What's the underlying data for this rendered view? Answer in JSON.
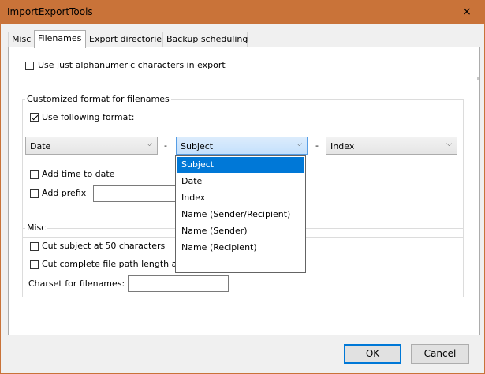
{
  "window": {
    "title": "ImportExportTools",
    "close_icon": "×"
  },
  "tabs": [
    {
      "label": "Misc"
    },
    {
      "label": "Filenames"
    },
    {
      "label": "Export directories"
    },
    {
      "label": "Backup scheduling"
    }
  ],
  "filenames": {
    "alnum_checkbox_label": "Use just alphanumeric characters in export",
    "alnum_checked": false,
    "custom_group_title": "Customized format for filenames",
    "use_format_label": "Use following format:",
    "use_format_checked": true,
    "select1_value": "Date",
    "select2_value": "Subject",
    "select3_value": "Index",
    "separator1": "-",
    "separator2": "-",
    "add_time_label": "Add time to date",
    "add_prefix_label": "Add prefix",
    "prefix_value": "",
    "dropdown_options": [
      "Subject",
      "Date",
      "Index",
      "Name (Sender/Recipient)",
      "Name (Sender)",
      "Name (Recipient)"
    ],
    "dropdown_selected": "Subject",
    "misc_group_title": "Misc",
    "cut_subject_label": "Cut subject at 50 characters",
    "cut_path_label": "Cut complete file path length at",
    "charset_label": "Charset for filenames:",
    "charset_value": ""
  },
  "buttons": {
    "ok": "OK",
    "cancel": "Cancel"
  },
  "colors": {
    "titlebar": "#c97339",
    "selection": "#0078d7",
    "dialog_bg": "#f0f0f0"
  }
}
